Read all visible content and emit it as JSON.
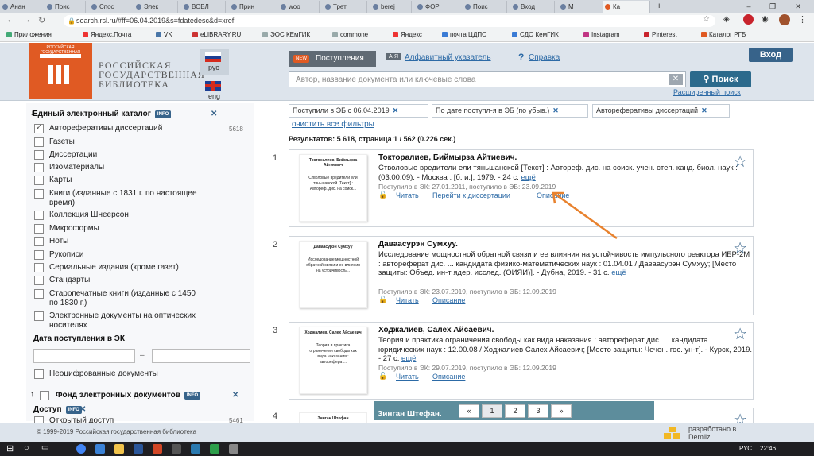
{
  "browser": {
    "tabs": [
      "Анан",
      "Поис",
      "Спос",
      "Элек",
      "ВОВЛ",
      "Прин",
      "woo",
      "Трет",
      "berej",
      "ФОР",
      "Поис",
      "Вход",
      "М",
      "Ка"
    ],
    "url": "search.rsl.ru/#ff=06.04.2019&s=fdatedesc&d=xref",
    "bookmarks": [
      "Приложения",
      "Яндекс.Почта",
      "VK",
      "eLIBRARY.RU",
      "ЭОС КЕмГИК",
      "commone",
      "Яндекс",
      "почта ЦДПО",
      "СДО КемГИК",
      "Instagram",
      "Pinterest",
      "Каталог РГБ"
    ]
  },
  "header": {
    "logo_text": "РОССИЙСКАЯ ГОСУДАРСТВЕННАЯ БИБЛИОТЕКА",
    "site_name_1": "РОССИЙСКАЯ",
    "site_name_2": "ГОСУДАРСТВЕННАЯ",
    "site_name_3": "БИБЛИОТЕКА",
    "lang_ru": "рус",
    "lang_en": "eng",
    "new_badge": "NEW",
    "tab_new": "Поступления",
    "alpha_badge": "А-Я",
    "alpha_index": "Алфавитный указатель",
    "help": "Справка",
    "search_placeholder": "Автор, название документа или ключевые слова",
    "search_button": "Поиск",
    "advanced": "Расширенный поиск",
    "login": "Вход"
  },
  "sidebar": {
    "catalog_title": "Единый электронный каталог",
    "info": "INFO",
    "options": [
      {
        "label": "Автореферативы диссертаций",
        "count": "5618",
        "checked": true
      },
      {
        "label": "Газеты"
      },
      {
        "label": "Диссертации"
      },
      {
        "label": "Изоматериалы"
      },
      {
        "label": "Карты"
      },
      {
        "label": "Книги (изданные с 1831 г. по настоящее",
        "label2": "время)"
      },
      {
        "label": "Коллекция Шнеерсон"
      },
      {
        "label": "Микроформы"
      },
      {
        "label": "Ноты"
      },
      {
        "label": "Рукописи"
      },
      {
        "label": "Сериальные издания (кроме газет)"
      },
      {
        "label": "Стандарты"
      },
      {
        "label": "Старопечатные книги (изданные с 1450",
        "label2": "по 1830 г.)"
      },
      {
        "label": "Электронные документы на оптических",
        "label2": "носителях"
      }
    ],
    "date_title": "Дата поступления в ЭК",
    "date_sep": "–",
    "non_digit": "Неоцифрованные документы",
    "fund_title": "Фонд электронных документов",
    "access_title": "Доступ",
    "open_access": "Открытый доступ",
    "open_count": "5461"
  },
  "filters": {
    "chips": [
      "Поступили в ЭБ с 06.04.2019",
      "По дате поступл-я в ЭБ (по убыв.)",
      "Автореферативы диссертаций"
    ],
    "clear": "очистить все фильтры",
    "results": "Результатов: 5 618, страница 1 / 562 (0.226 сек.)"
  },
  "results": [
    {
      "num": "1",
      "cover_author": "Токтоналиев, Биймырза Айтиевич",
      "cover_title": "Стволовые вредители ели тяньшанской [Текст] : Автореф. дис. на соиск...",
      "title": "Токторалиев, Биймырза Айтиевич.",
      "desc": "Стволовые вредители ели тяньшанской [Текст] : Автореф. дис. на соиск. учен. степ. канд. биол. наук : (03.00.09). - Москва : [б. и.], 1979. - 24 с.",
      "more": "ещё",
      "date": "Поступило в ЭК: 27.01.2011, поступило в ЭБ: 23.09.2019",
      "read": "Читать",
      "go": "Перейти к диссертации",
      "descr": "Описание"
    },
    {
      "num": "2",
      "cover_author": "Даваасурэн Сумхуу",
      "cover_title": "Исследование мощностной обратной связи и ее влияния на устойчивость...",
      "title": "Даваасурэн Сумхуу.",
      "desc": "Исследование мощностной обратной связи и ее влияния на устойчивость импульсного реактора ИБР-2М : автореферат дис. ... кандидата физико-математических наук : 01.04.01 / Даваасурэн Сумхуу; [Место защиты: Объед. ин-т ядер. исслед. (ОИЯИ)]. - Дубна, 2019. - 31 с.",
      "more": "ещё",
      "date": "Поступило в ЭК: 23.07.2019, поступило в ЭБ: 12.09.2019",
      "read": "Читать",
      "descr": "Описание"
    },
    {
      "num": "3",
      "cover_author": "Ходжалиев, Салех Айсаевич",
      "cover_title": "Теория и практика ограничения свободы как вида наказания : автореферат...",
      "title": "Ходжалиев, Салех Айсаевич.",
      "desc": "Теория и практика ограничения свободы как вида наказания : автореферат дис. ... кандидата юридических наук : 12.00.08 / Ходжалиев Салех Айсаевич; [Место защиты: Чечен. гос. ун-т]. - Курск, 2019. - 27 с.",
      "more": "ещё",
      "date": "Поступило в ЭК: 29.07.2019, поступило в ЭБ: 12.09.2019",
      "read": "Читать",
      "descr": "Описание"
    },
    {
      "num": "4",
      "cover_author": "Зинган Штефан",
      "title": "Зинган Штефан."
    }
  ],
  "pager": {
    "prev": "«",
    "pages": [
      "1",
      "2",
      "3"
    ],
    "next": "»"
  },
  "footer": {
    "copyright": "© 1999-2019 Российская государственная библиотека",
    "demliz1": "разработано в",
    "demliz2": "Demliz"
  },
  "taskbar": {
    "lang": "РУС",
    "time": "22:46"
  },
  "colors": {
    "brand_orange": "#e05a23",
    "accent_blue": "#37638a",
    "link": "#2c6aa6"
  }
}
